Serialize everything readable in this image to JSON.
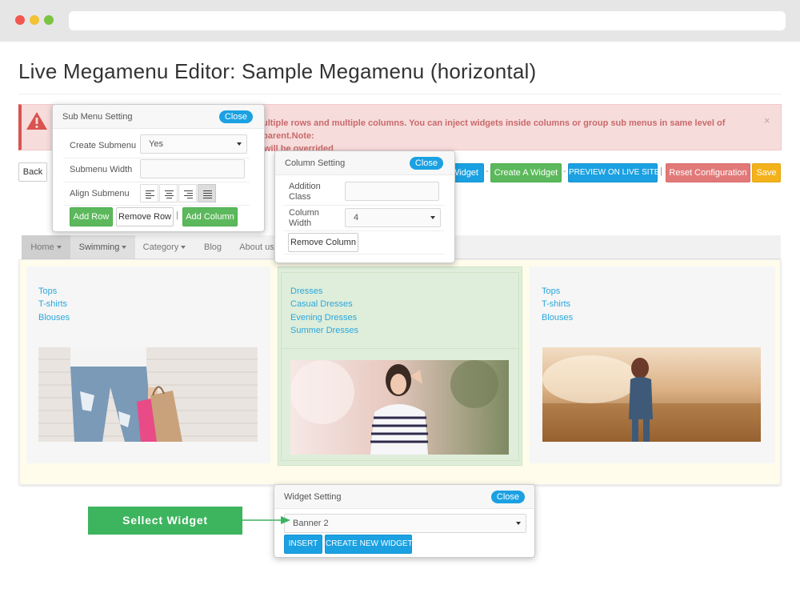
{
  "page": {
    "title": "Live Megamenu Editor: Sample Megamenu (horizontal)"
  },
  "alert": {
    "line1": "ultiple rows and multiple columns. You can inject widgets inside columns or group sub menus in same level of parent.Note:",
    "line2": "will be overrided",
    "close": "×"
  },
  "toolbar": {
    "back": "Back",
    "widget_partial": "Widget",
    "create_widget": "Create A Widget",
    "preview": "PREVIEW ON LIVE SITE",
    "reset": "Reset Configuration",
    "save": "Save",
    "separator": "|",
    "dash": "-"
  },
  "nav": {
    "items": [
      {
        "label": "Home",
        "dropdown": true
      },
      {
        "label": "Swimming",
        "dropdown": true
      },
      {
        "label": "Category",
        "dropdown": true
      },
      {
        "label": "Blog",
        "dropdown": false
      },
      {
        "label": "About us",
        "dropdown": false
      }
    ]
  },
  "columns": [
    {
      "links": [
        "Tops",
        "T-shirts",
        "Blouses"
      ]
    },
    {
      "links": [
        "Dresses",
        "Casual Dresses",
        "Evening Dresses",
        "Summer Dresses"
      ]
    },
    {
      "links": [
        "Tops",
        "T-shirts",
        "Blouses"
      ]
    }
  ],
  "submenu_popover": {
    "title": "Sub Menu Setting",
    "close": "Close",
    "create_label": "Create Submenu",
    "create_value": "Yes",
    "width_label": "Submenu Width",
    "align_label": "Align Submenu",
    "add_row": "Add Row",
    "remove_row": "Remove Row",
    "add_column": "Add Column",
    "separator": "|"
  },
  "column_popover": {
    "title": "Column Setting",
    "close": "Close",
    "class_label_1": "Addition",
    "class_label_2": "Class",
    "width_label_1": "Column",
    "width_label_2": "Width",
    "width_value": "4",
    "remove_column": "Remove Column"
  },
  "widget_popover": {
    "title": "Widget Setting",
    "close": "Close",
    "selected": "Banner 2",
    "insert": "INSERT",
    "create_new": "CREATE NEW WIDGET"
  },
  "callout": {
    "label": "Sellect Widget"
  },
  "colors": {
    "accent_blue": "#1ba1e2",
    "green": "#5cb85c",
    "red": "#e27979",
    "orange": "#f3b21b",
    "callout_green": "#3db45e"
  },
  "icons": [
    "warning-icon",
    "caret-down-icon",
    "align-left-icon",
    "align-center-icon",
    "align-right-icon",
    "align-justify-icon"
  ]
}
